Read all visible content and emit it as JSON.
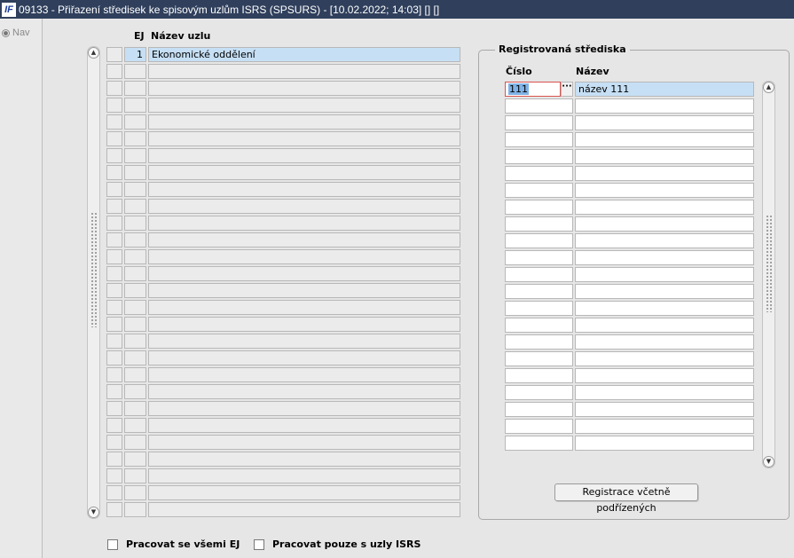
{
  "window": {
    "title": "09133 - Přiřazení středisek ke spisovým uzlům ISRS (SPSURS) - [10.02.2022; 14:03]  []  []",
    "icon": "app-logo-icon"
  },
  "nav": {
    "label": "Nav"
  },
  "nodes": {
    "col_ej": "EJ",
    "col_name": "Název uzlu",
    "rows": [
      {
        "ej": "1",
        "name": "Ekonomické oddělení"
      },
      {
        "ej": "",
        "name": ""
      },
      {
        "ej": "",
        "name": ""
      },
      {
        "ej": "",
        "name": ""
      },
      {
        "ej": "",
        "name": ""
      },
      {
        "ej": "",
        "name": ""
      },
      {
        "ej": "",
        "name": ""
      },
      {
        "ej": "",
        "name": ""
      },
      {
        "ej": "",
        "name": ""
      },
      {
        "ej": "",
        "name": ""
      },
      {
        "ej": "",
        "name": ""
      },
      {
        "ej": "",
        "name": ""
      },
      {
        "ej": "",
        "name": ""
      },
      {
        "ej": "",
        "name": ""
      },
      {
        "ej": "",
        "name": ""
      },
      {
        "ej": "",
        "name": ""
      },
      {
        "ej": "",
        "name": ""
      },
      {
        "ej": "",
        "name": ""
      },
      {
        "ej": "",
        "name": ""
      },
      {
        "ej": "",
        "name": ""
      },
      {
        "ej": "",
        "name": ""
      },
      {
        "ej": "",
        "name": ""
      },
      {
        "ej": "",
        "name": ""
      },
      {
        "ej": "",
        "name": ""
      },
      {
        "ej": "",
        "name": ""
      },
      {
        "ej": "",
        "name": ""
      },
      {
        "ej": "",
        "name": ""
      },
      {
        "ej": "",
        "name": ""
      }
    ]
  },
  "centers": {
    "title": "Registrovaná střediska",
    "col_number": "Číslo",
    "col_name": "Název",
    "lov_label": "···",
    "rows": [
      {
        "number": "111",
        "name": "název 111"
      },
      {
        "number": "",
        "name": ""
      },
      {
        "number": "",
        "name": ""
      },
      {
        "number": "",
        "name": ""
      },
      {
        "number": "",
        "name": ""
      },
      {
        "number": "",
        "name": ""
      },
      {
        "number": "",
        "name": ""
      },
      {
        "number": "",
        "name": ""
      },
      {
        "number": "",
        "name": ""
      },
      {
        "number": "",
        "name": ""
      },
      {
        "number": "",
        "name": ""
      },
      {
        "number": "",
        "name": ""
      },
      {
        "number": "",
        "name": ""
      },
      {
        "number": "",
        "name": ""
      },
      {
        "number": "",
        "name": ""
      },
      {
        "number": "",
        "name": ""
      },
      {
        "number": "",
        "name": ""
      },
      {
        "number": "",
        "name": ""
      },
      {
        "number": "",
        "name": ""
      },
      {
        "number": "",
        "name": ""
      },
      {
        "number": "",
        "name": ""
      },
      {
        "number": "",
        "name": ""
      }
    ],
    "button_label": "Registrace včetně podřízených"
  },
  "options": {
    "all_ej": {
      "label": "Pracovat se všemi EJ",
      "checked": false
    },
    "isrs_only": {
      "label": "Pracovat pouze s uzly ISRS",
      "checked": false
    }
  },
  "colors": {
    "titlebar": "#2f3f5c",
    "row_highlight": "#c6dff4",
    "text_selection": "#7fb2e6",
    "focus_border": "#d9534f"
  }
}
